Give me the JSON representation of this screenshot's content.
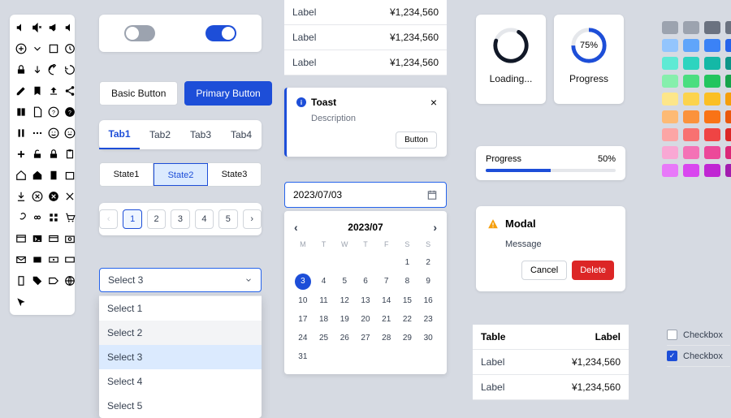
{
  "toggles": {
    "off": false,
    "on": true
  },
  "buttons": {
    "basic": "Basic Button",
    "primary": "Primary Button"
  },
  "tabs": [
    "Tab1",
    "Tab2",
    "Tab3",
    "Tab4"
  ],
  "active_tab": 0,
  "states": [
    "State1",
    "State2",
    "State3"
  ],
  "active_state": 1,
  "pager": {
    "pages": [
      "1",
      "2",
      "3",
      "4",
      "5"
    ],
    "current": 0
  },
  "select": {
    "value": "Select 3",
    "options": [
      "Select 1",
      "Select 2",
      "Select 3",
      "Select 4",
      "Select 5"
    ],
    "selected": 2,
    "hover": 1
  },
  "table1": [
    {
      "label": "Label",
      "value": "¥1,234,560"
    },
    {
      "label": "Label",
      "value": "¥1,234,560"
    },
    {
      "label": "Label",
      "value": "¥1,234,560"
    }
  ],
  "toast": {
    "title": "Toast",
    "description": "Description",
    "button": "Button"
  },
  "date": {
    "value": "2023/07/03",
    "month_label": "2023/07",
    "dow": [
      "M",
      "T",
      "W",
      "T",
      "F",
      "S",
      "S"
    ],
    "selected_day": 3
  },
  "loading": {
    "label": "Loading..."
  },
  "progress_circle": {
    "label": "Progress",
    "percent": "75%",
    "value": 75
  },
  "progress_bar": {
    "label": "Progress",
    "percent": "50%",
    "value": 50
  },
  "modal": {
    "title": "Modal",
    "message": "Message",
    "cancel": "Cancel",
    "delete": "Delete"
  },
  "table2": {
    "header": {
      "col1": "Table",
      "col2": "Label"
    },
    "rows": [
      {
        "label": "Label",
        "value": "¥1,234,560"
      },
      {
        "label": "Label",
        "value": "¥1,234,560"
      }
    ]
  },
  "swatch_rows": [
    [
      "#9CA3AF",
      "#9CA3AF",
      "#6B7280",
      "#6B7280"
    ],
    [
      "#93C5FD",
      "#60A5FA",
      "#3B82F6",
      "#2563EB"
    ],
    [
      "#5EEAD4",
      "#2DD4BF",
      "#14B8A6",
      "#0D9488"
    ],
    [
      "#86EFAC",
      "#4ADE80",
      "#22C55E",
      "#16A34A"
    ],
    [
      "#FDE68A",
      "#FCD34D",
      "#FBBF24",
      "#F59E0B"
    ],
    [
      "#FDBA74",
      "#FB923C",
      "#F97316",
      "#EA580C"
    ],
    [
      "#FCA5A5",
      "#F87171",
      "#EF4444",
      "#DC2626"
    ],
    [
      "#F9A8D4",
      "#F472B6",
      "#EC4899",
      "#DB2777"
    ],
    [
      "#E879F9",
      "#D946EF",
      "#C026D3",
      "#A21CAF"
    ]
  ],
  "checkboxes": [
    {
      "label": "Checkbox",
      "checked": false
    },
    {
      "label": "Checkbox",
      "checked": true
    }
  ]
}
